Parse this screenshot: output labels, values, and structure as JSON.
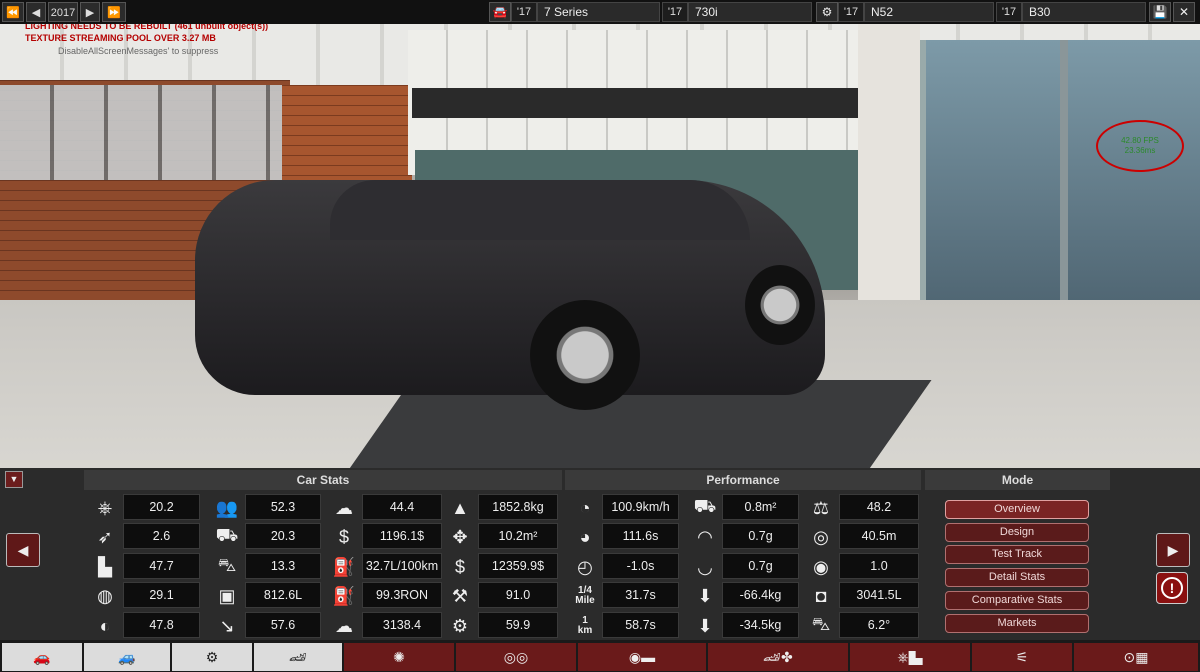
{
  "topbar": {
    "year": "2017",
    "model_year": "'17",
    "model": "7 Series",
    "trim_year": "'17",
    "trim": "730i",
    "engine_year": "'17",
    "engine": "N52",
    "variant_year": "'17",
    "variant": "B30"
  },
  "debug": {
    "line1": "LIGHTING NEEDS TO BE REBUILT (461 unbuilt object(s))",
    "line2": "TEXTURE STREAMING POOL OVER 3.27 MB",
    "line3": "DisableAllScreenMessages' to suppress",
    "fps": "42.80 FPS",
    "ms": "23.36ms"
  },
  "headers": {
    "car_stats": "Car Stats",
    "performance": "Performance",
    "mode": "Mode"
  },
  "car_stats": [
    {
      "icon": "steering-wheel-icon",
      "glyph": "⎈",
      "value": "20.2"
    },
    {
      "icon": "feather-icon",
      "glyph": "➶",
      "value": "2.6"
    },
    {
      "icon": "seat-icon",
      "glyph": "▙",
      "value": "47.7"
    },
    {
      "icon": "ring-icon",
      "glyph": "◍",
      "value": "29.1"
    },
    {
      "icon": "checker-icon",
      "glyph": "◐",
      "value": "47.8"
    },
    {
      "icon": "passengers-icon",
      "glyph": "👥",
      "value": "52.3"
    },
    {
      "icon": "pickup-icon",
      "glyph": "⛟",
      "value": "20.3"
    },
    {
      "icon": "utility-icon",
      "glyph": "⛍",
      "value": "13.3"
    },
    {
      "icon": "cargo-box-icon",
      "glyph": "▣",
      "value": "812.6L"
    },
    {
      "icon": "tow-arrow-icon",
      "glyph": "↘",
      "value": "57.6"
    },
    {
      "icon": "pollution-icon",
      "glyph": "☁",
      "value": "44.4"
    },
    {
      "icon": "cost-icon",
      "glyph": "$",
      "value": "1196.1$"
    },
    {
      "icon": "fuel-can-icon",
      "glyph": "⛽",
      "value": "32.7L/100km"
    },
    {
      "icon": "fuel-octane-icon",
      "glyph": "⛽",
      "value": "99.3RON"
    },
    {
      "icon": "emissions-icon",
      "glyph": "☁",
      "value": "3138.4"
    },
    {
      "icon": "weight-icon",
      "glyph": "▲",
      "value": "1852.8kg"
    },
    {
      "icon": "area-icon",
      "glyph": "✥",
      "value": "10.2m²"
    },
    {
      "icon": "money-bag-icon",
      "glyph": "$",
      "value": "12359.9$"
    },
    {
      "icon": "anvil-icon",
      "glyph": "⚒",
      "value": "91.0"
    },
    {
      "icon": "tools-icon",
      "glyph": "⚙",
      "value": "59.9"
    }
  ],
  "performance": [
    {
      "icon": "speedometer-icon",
      "glyph": "◔",
      "value": "100.9km/h"
    },
    {
      "icon": "acceleration-icon",
      "glyph": "◕",
      "value": "111.6s"
    },
    {
      "icon": "gauge-icon",
      "glyph": "◴",
      "value": "-1.0s"
    },
    {
      "icon": "quarter-mile-icon",
      "glyph": "¼",
      "value": "31.7s"
    },
    {
      "icon": "km-icon",
      "glyph": "1",
      "value": "58.7s"
    },
    {
      "icon": "frontal-area-icon",
      "glyph": "⛟",
      "value": "0.8m²"
    },
    {
      "icon": "cornering-icon",
      "glyph": "◠",
      "value": "0.7g"
    },
    {
      "icon": "cornering-2-icon",
      "glyph": "◡",
      "value": "0.7g"
    },
    {
      "icon": "downforce-front-icon",
      "glyph": "⬇",
      "value": "-66.4kg"
    },
    {
      "icon": "downforce-rear-icon",
      "glyph": "⬇",
      "value": "-34.5kg"
    },
    {
      "icon": "balance-icon",
      "glyph": "⚖",
      "value": "48.2"
    },
    {
      "icon": "brake-disc-icon",
      "glyph": "◎",
      "value": "40.5m"
    },
    {
      "icon": "brake-fade-icon",
      "glyph": "◉",
      "value": "1.0"
    },
    {
      "icon": "volume-icon",
      "glyph": "◘",
      "value": "3041.5L"
    },
    {
      "icon": "incline-icon",
      "glyph": "⛍",
      "value": "6.2°"
    }
  ],
  "mode_buttons": [
    "Overview",
    "Design",
    "Test Track",
    "Detail Stats",
    "Comparative Stats",
    "Markets"
  ],
  "quarter_label_top": "1/4",
  "quarter_label_bottom": "Mile",
  "km_label_top": "1",
  "km_label_bottom": "km"
}
